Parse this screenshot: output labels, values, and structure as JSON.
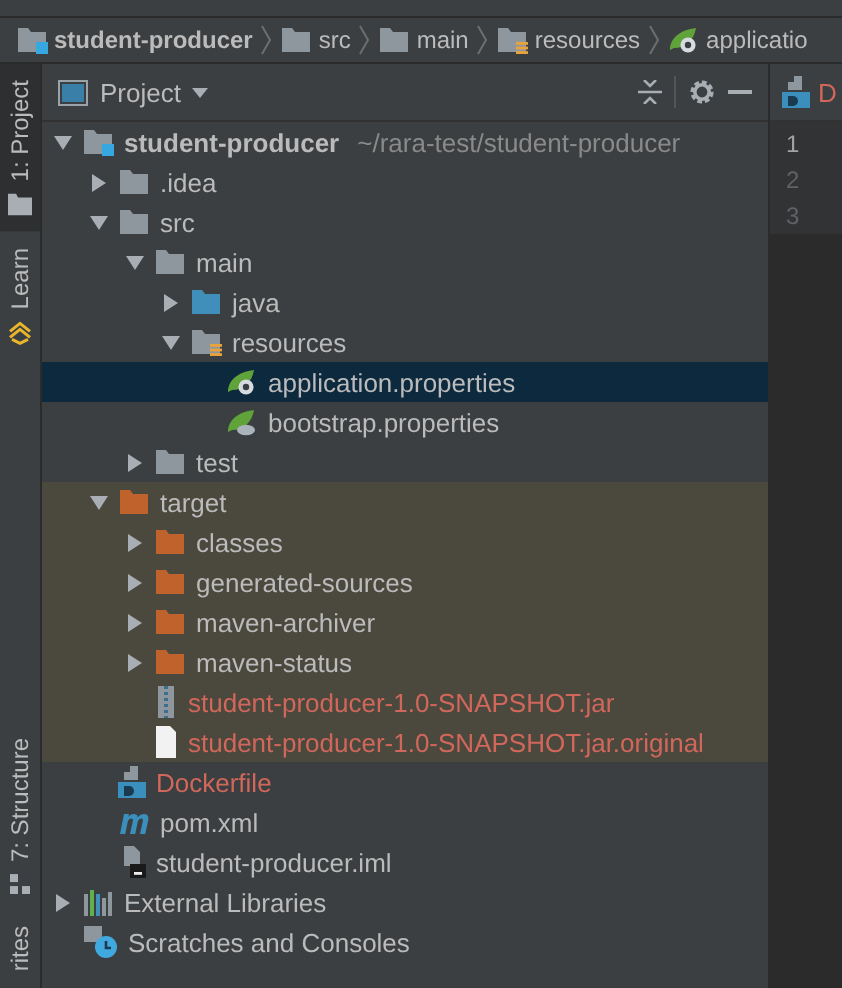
{
  "breadcrumbs": [
    {
      "label": "student-producer",
      "kind": "module"
    },
    {
      "label": "src",
      "kind": "folder"
    },
    {
      "label": "main",
      "kind": "folder"
    },
    {
      "label": "resources",
      "kind": "resources-folder"
    },
    {
      "label": "applicatio",
      "kind": "spring-file"
    }
  ],
  "tool_strip": [
    {
      "label": "1: Project",
      "kind": "project",
      "selected": true
    },
    {
      "label": "Learn",
      "kind": "learn",
      "selected": false
    },
    {
      "label": "7: Structure",
      "kind": "structure",
      "selected": false
    },
    {
      "label": "rites",
      "kind": "plain",
      "selected": false
    }
  ],
  "project_panel": {
    "title": "Project",
    "tree": [
      {
        "name": "student-producer",
        "hint": "~/rara-test/student-producer",
        "kind": "module",
        "expanded": true,
        "selected": false,
        "ignored": false,
        "excluded": false,
        "children": [
          {
            "name": ".idea",
            "kind": "folder",
            "expanded": false,
            "selected": false,
            "ignored": false,
            "excluded": false
          },
          {
            "name": "src",
            "kind": "folder",
            "expanded": true,
            "selected": false,
            "ignored": false,
            "excluded": false,
            "children": [
              {
                "name": "main",
                "kind": "folder",
                "expanded": true,
                "selected": false,
                "ignored": false,
                "excluded": false,
                "children": [
                  {
                    "name": "java",
                    "kind": "source-folder",
                    "expanded": false,
                    "selected": false,
                    "ignored": false,
                    "excluded": false
                  },
                  {
                    "name": "resources",
                    "kind": "resources-folder",
                    "expanded": true,
                    "selected": false,
                    "ignored": false,
                    "excluded": false,
                    "children": [
                      {
                        "name": "application.properties",
                        "kind": "spring-file",
                        "selected": true,
                        "ignored": false,
                        "excluded": false
                      },
                      {
                        "name": "bootstrap.properties",
                        "kind": "spring-cloud-file",
                        "selected": false,
                        "ignored": false,
                        "excluded": false
                      }
                    ]
                  }
                ]
              },
              {
                "name": "test",
                "kind": "folder",
                "expanded": false,
                "selected": false,
                "ignored": false,
                "excluded": false
              }
            ]
          },
          {
            "name": "target",
            "kind": "excluded-folder",
            "expanded": true,
            "selected": false,
            "ignored": false,
            "excluded": true,
            "children": [
              {
                "name": "classes",
                "kind": "excluded-folder",
                "expanded": false,
                "selected": false,
                "ignored": false,
                "excluded": true
              },
              {
                "name": "generated-sources",
                "kind": "excluded-folder",
                "expanded": false,
                "selected": false,
                "ignored": false,
                "excluded": true
              },
              {
                "name": "maven-archiver",
                "kind": "excluded-folder",
                "expanded": false,
                "selected": false,
                "ignored": false,
                "excluded": true
              },
              {
                "name": "maven-status",
                "kind": "excluded-folder",
                "expanded": false,
                "selected": false,
                "ignored": false,
                "excluded": true
              },
              {
                "name": "student-producer-1.0-SNAPSHOT.jar",
                "kind": "jar",
                "selected": false,
                "ignored": true,
                "excluded": true
              },
              {
                "name": "student-producer-1.0-SNAPSHOT.jar.original",
                "kind": "file",
                "selected": false,
                "ignored": true,
                "excluded": true
              }
            ]
          },
          {
            "name": "Dockerfile",
            "kind": "docker",
            "selected": false,
            "ignored": true,
            "excluded": false
          },
          {
            "name": "pom.xml",
            "kind": "maven",
            "selected": false,
            "ignored": false,
            "excluded": false
          },
          {
            "name": "student-producer.iml",
            "kind": "iml",
            "selected": false,
            "ignored": false,
            "excluded": false
          }
        ]
      },
      {
        "name": "External Libraries",
        "kind": "libraries",
        "expanded": false,
        "selected": false,
        "ignored": false,
        "excluded": false
      },
      {
        "name": "Scratches and Consoles",
        "kind": "scratches",
        "selected": false,
        "ignored": false,
        "excluded": false
      }
    ]
  },
  "editor": {
    "tab": "D",
    "line_numbers": [
      "1",
      "2",
      "3"
    ]
  }
}
